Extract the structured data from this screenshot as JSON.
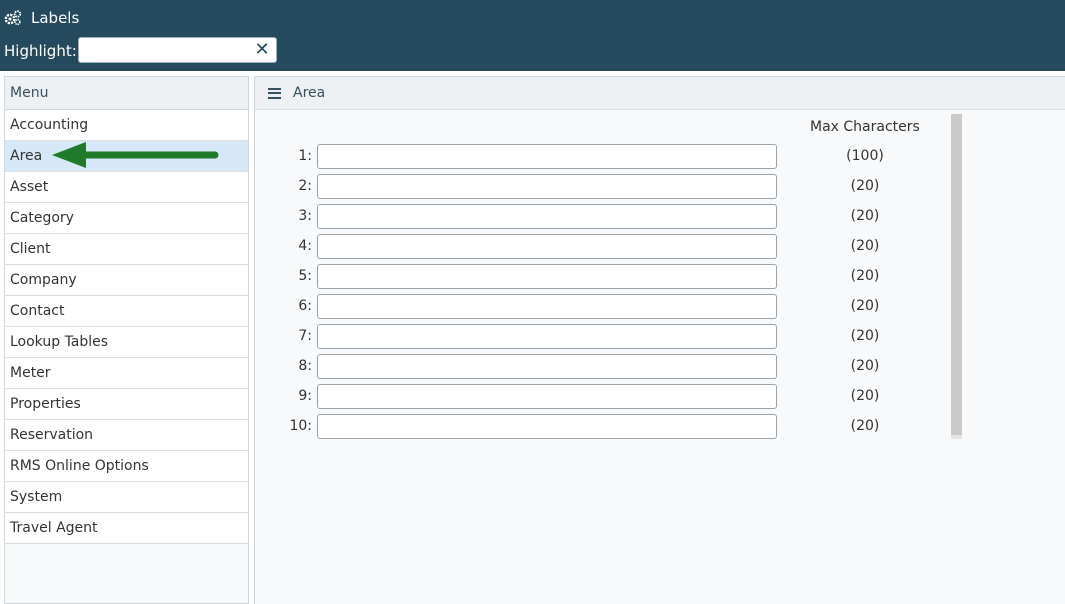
{
  "header": {
    "title": "Labels",
    "icon": "gears-icon",
    "highlight_label": "Highlight:",
    "highlight_value": "",
    "highlight_placeholder": "",
    "clear_glyph": "✕",
    "colors": {
      "header_bg": "#254a5e",
      "selected_item_bg": "#d6e8f7",
      "arrow": "#1f7a2a"
    }
  },
  "sidebar": {
    "heading": "Menu",
    "items": [
      {
        "label": "Accounting"
      },
      {
        "label": "Area",
        "selected": true
      },
      {
        "label": "Asset"
      },
      {
        "label": "Category"
      },
      {
        "label": "Client"
      },
      {
        "label": "Company"
      },
      {
        "label": "Contact"
      },
      {
        "label": "Lookup Tables"
      },
      {
        "label": "Meter"
      },
      {
        "label": "Properties"
      },
      {
        "label": "Reservation"
      },
      {
        "label": "RMS Online Options"
      },
      {
        "label": "System"
      },
      {
        "label": "Travel Agent"
      }
    ]
  },
  "main": {
    "title": "Area",
    "max_chars_heading": "Max Characters",
    "rows": [
      {
        "num": "1:",
        "value": "",
        "max": "(100)"
      },
      {
        "num": "2:",
        "value": "",
        "max": "(20)"
      },
      {
        "num": "3:",
        "value": "",
        "max": "(20)"
      },
      {
        "num": "4:",
        "value": "",
        "max": "(20)"
      },
      {
        "num": "5:",
        "value": "",
        "max": "(20)"
      },
      {
        "num": "6:",
        "value": "",
        "max": "(20)"
      },
      {
        "num": "7:",
        "value": "",
        "max": "(20)"
      },
      {
        "num": "8:",
        "value": "",
        "max": "(20)"
      },
      {
        "num": "9:",
        "value": "",
        "max": "(20)"
      },
      {
        "num": "10:",
        "value": "",
        "max": "(20)"
      }
    ]
  }
}
